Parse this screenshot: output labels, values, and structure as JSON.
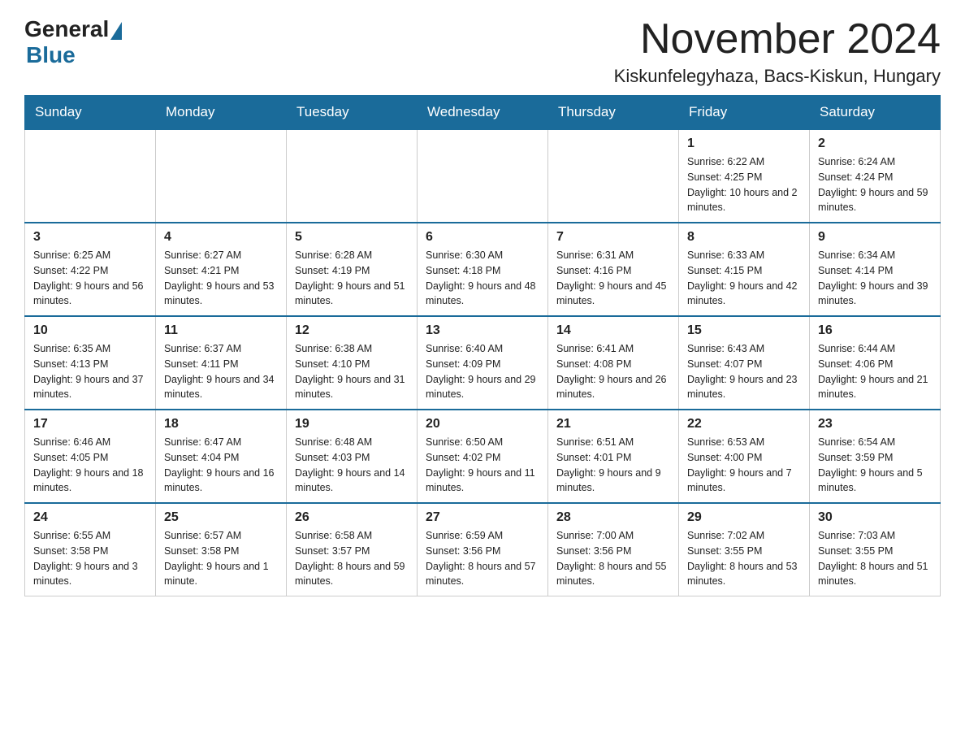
{
  "header": {
    "logo_general": "General",
    "logo_blue": "Blue",
    "month_title": "November 2024",
    "location": "Kiskunfelegyhaza, Bacs-Kiskun, Hungary"
  },
  "weekdays": [
    "Sunday",
    "Monday",
    "Tuesday",
    "Wednesday",
    "Thursday",
    "Friday",
    "Saturday"
  ],
  "weeks": [
    [
      {
        "day": "",
        "info": ""
      },
      {
        "day": "",
        "info": ""
      },
      {
        "day": "",
        "info": ""
      },
      {
        "day": "",
        "info": ""
      },
      {
        "day": "",
        "info": ""
      },
      {
        "day": "1",
        "info": "Sunrise: 6:22 AM\nSunset: 4:25 PM\nDaylight: 10 hours and 2 minutes."
      },
      {
        "day": "2",
        "info": "Sunrise: 6:24 AM\nSunset: 4:24 PM\nDaylight: 9 hours and 59 minutes."
      }
    ],
    [
      {
        "day": "3",
        "info": "Sunrise: 6:25 AM\nSunset: 4:22 PM\nDaylight: 9 hours and 56 minutes."
      },
      {
        "day": "4",
        "info": "Sunrise: 6:27 AM\nSunset: 4:21 PM\nDaylight: 9 hours and 53 minutes."
      },
      {
        "day": "5",
        "info": "Sunrise: 6:28 AM\nSunset: 4:19 PM\nDaylight: 9 hours and 51 minutes."
      },
      {
        "day": "6",
        "info": "Sunrise: 6:30 AM\nSunset: 4:18 PM\nDaylight: 9 hours and 48 minutes."
      },
      {
        "day": "7",
        "info": "Sunrise: 6:31 AM\nSunset: 4:16 PM\nDaylight: 9 hours and 45 minutes."
      },
      {
        "day": "8",
        "info": "Sunrise: 6:33 AM\nSunset: 4:15 PM\nDaylight: 9 hours and 42 minutes."
      },
      {
        "day": "9",
        "info": "Sunrise: 6:34 AM\nSunset: 4:14 PM\nDaylight: 9 hours and 39 minutes."
      }
    ],
    [
      {
        "day": "10",
        "info": "Sunrise: 6:35 AM\nSunset: 4:13 PM\nDaylight: 9 hours and 37 minutes."
      },
      {
        "day": "11",
        "info": "Sunrise: 6:37 AM\nSunset: 4:11 PM\nDaylight: 9 hours and 34 minutes."
      },
      {
        "day": "12",
        "info": "Sunrise: 6:38 AM\nSunset: 4:10 PM\nDaylight: 9 hours and 31 minutes."
      },
      {
        "day": "13",
        "info": "Sunrise: 6:40 AM\nSunset: 4:09 PM\nDaylight: 9 hours and 29 minutes."
      },
      {
        "day": "14",
        "info": "Sunrise: 6:41 AM\nSunset: 4:08 PM\nDaylight: 9 hours and 26 minutes."
      },
      {
        "day": "15",
        "info": "Sunrise: 6:43 AM\nSunset: 4:07 PM\nDaylight: 9 hours and 23 minutes."
      },
      {
        "day": "16",
        "info": "Sunrise: 6:44 AM\nSunset: 4:06 PM\nDaylight: 9 hours and 21 minutes."
      }
    ],
    [
      {
        "day": "17",
        "info": "Sunrise: 6:46 AM\nSunset: 4:05 PM\nDaylight: 9 hours and 18 minutes."
      },
      {
        "day": "18",
        "info": "Sunrise: 6:47 AM\nSunset: 4:04 PM\nDaylight: 9 hours and 16 minutes."
      },
      {
        "day": "19",
        "info": "Sunrise: 6:48 AM\nSunset: 4:03 PM\nDaylight: 9 hours and 14 minutes."
      },
      {
        "day": "20",
        "info": "Sunrise: 6:50 AM\nSunset: 4:02 PM\nDaylight: 9 hours and 11 minutes."
      },
      {
        "day": "21",
        "info": "Sunrise: 6:51 AM\nSunset: 4:01 PM\nDaylight: 9 hours and 9 minutes."
      },
      {
        "day": "22",
        "info": "Sunrise: 6:53 AM\nSunset: 4:00 PM\nDaylight: 9 hours and 7 minutes."
      },
      {
        "day": "23",
        "info": "Sunrise: 6:54 AM\nSunset: 3:59 PM\nDaylight: 9 hours and 5 minutes."
      }
    ],
    [
      {
        "day": "24",
        "info": "Sunrise: 6:55 AM\nSunset: 3:58 PM\nDaylight: 9 hours and 3 minutes."
      },
      {
        "day": "25",
        "info": "Sunrise: 6:57 AM\nSunset: 3:58 PM\nDaylight: 9 hours and 1 minute."
      },
      {
        "day": "26",
        "info": "Sunrise: 6:58 AM\nSunset: 3:57 PM\nDaylight: 8 hours and 59 minutes."
      },
      {
        "day": "27",
        "info": "Sunrise: 6:59 AM\nSunset: 3:56 PM\nDaylight: 8 hours and 57 minutes."
      },
      {
        "day": "28",
        "info": "Sunrise: 7:00 AM\nSunset: 3:56 PM\nDaylight: 8 hours and 55 minutes."
      },
      {
        "day": "29",
        "info": "Sunrise: 7:02 AM\nSunset: 3:55 PM\nDaylight: 8 hours and 53 minutes."
      },
      {
        "day": "30",
        "info": "Sunrise: 7:03 AM\nSunset: 3:55 PM\nDaylight: 8 hours and 51 minutes."
      }
    ]
  ]
}
